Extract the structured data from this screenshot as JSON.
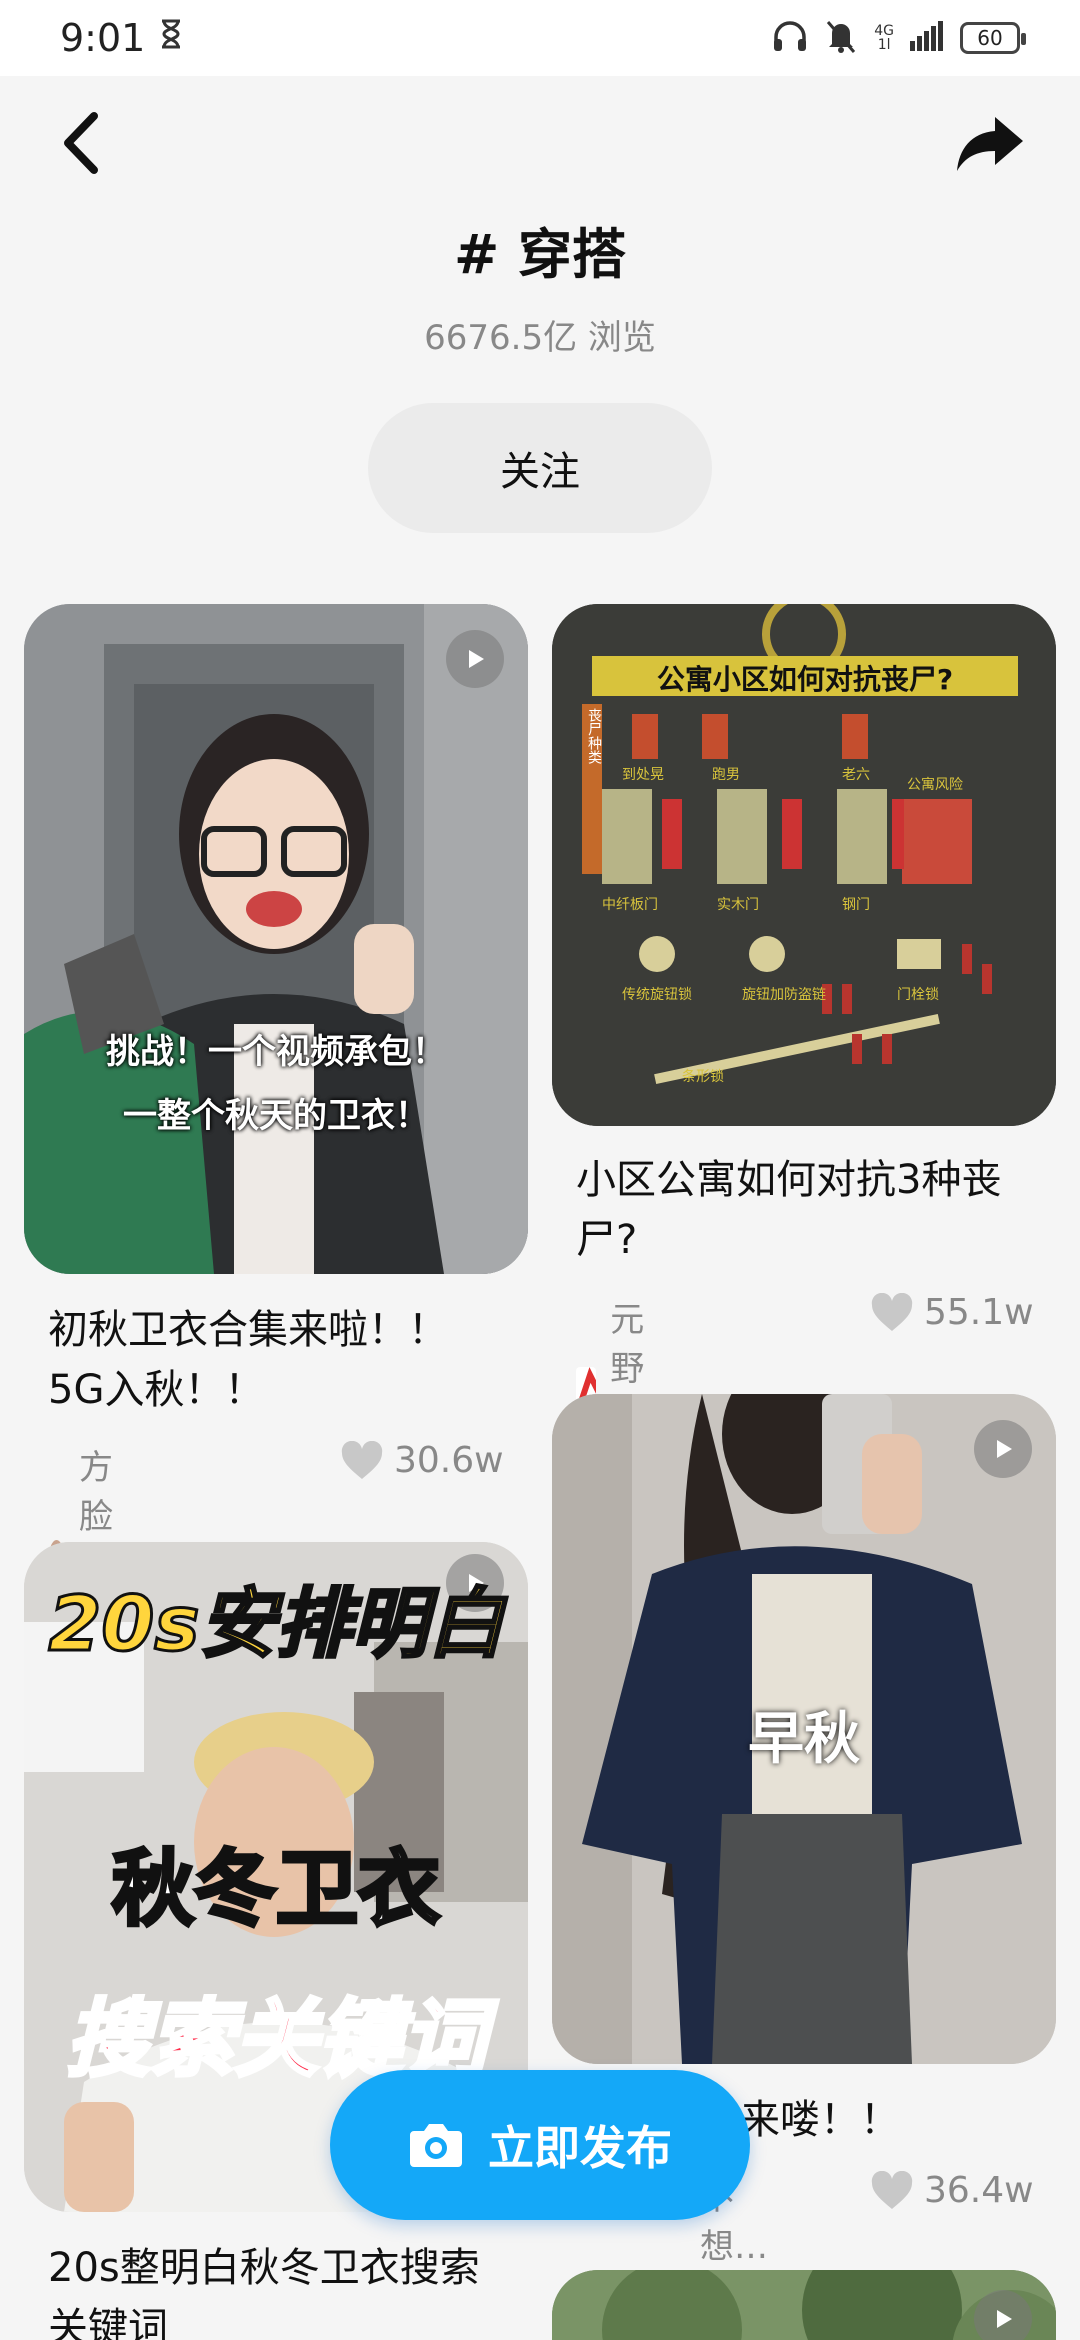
{
  "status": {
    "time": "9:01",
    "net_top": "4G",
    "net_bottom": "1l",
    "battery": "60"
  },
  "header": {
    "topic": "# 穿搭",
    "views": "6676.5亿 浏览",
    "follow_label": "关注"
  },
  "feed": {
    "left": [
      {
        "title": "初秋卫衣合集来啦！！5G入秋！！",
        "author": "方脸王大可",
        "likes": "30.6w",
        "overlay_line1": "挑战！一个视频承包！",
        "overlay_line2": "一整个秋天的卫衣！",
        "has_video": true
      },
      {
        "title": "20s整明白秋冬卫衣搜索关键词",
        "overlay_line1": "20s安排明白",
        "overlay_line2": "秋冬卫衣",
        "overlay_line3": "搜索关键词",
        "has_video": true
      }
    ],
    "right": [
      {
        "title": "小区公寓如何对抗3种丧尸?",
        "author": "元野户外",
        "likes": "55.1w",
        "poster_title": "公寓小区如何对抗丧尸?",
        "poster_side": "丧尸种类",
        "poster_labels": [
          "到处晃",
          "跑男",
          "老六",
          "中纤板门",
          "实木门",
          "钢门",
          "公寓风险",
          "传统旋钮锁",
          "旋钮加防盗链",
          "门栓锁",
          "条形锁"
        ]
      },
      {
        "title": "早秋穿搭来喽！！",
        "title_visible": "来喽！！",
        "author_visible": "不想…",
        "likes": "36.4w",
        "overlay_line1": "早秋",
        "has_video": true
      }
    ]
  },
  "publish": {
    "label": "立即发布"
  },
  "colors": {
    "accent": "#14a8f8",
    "muted": "#888888",
    "follow_bg": "#ebebeb"
  },
  "icons": [
    "back-arrow-icon",
    "share-arrow-icon",
    "play-icon",
    "heart-icon",
    "camera-icon",
    "headphones-icon",
    "mute-bell-icon",
    "signal-icon",
    "battery-icon",
    "hourglass-icon"
  ]
}
